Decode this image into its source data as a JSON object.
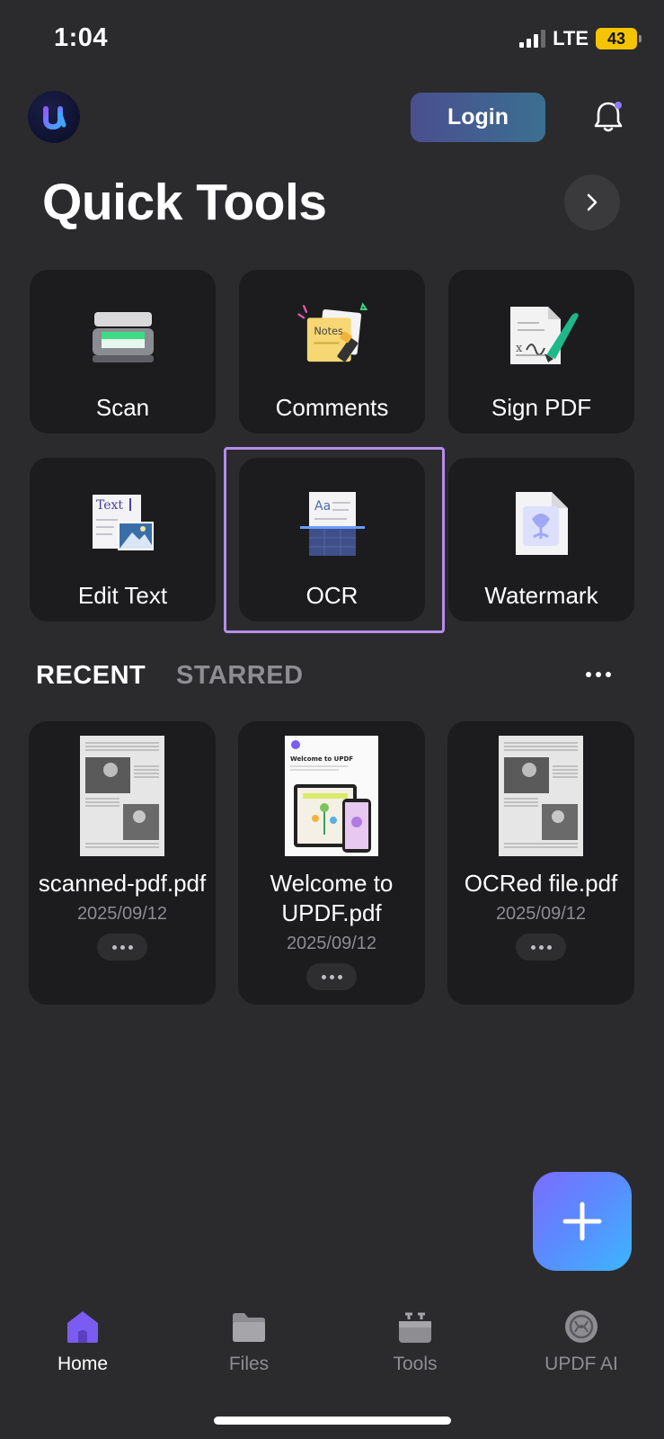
{
  "status": {
    "time": "1:04",
    "network": "LTE",
    "battery": "43"
  },
  "header": {
    "login_label": "Login"
  },
  "quick_tools": {
    "title": "Quick Tools",
    "items": [
      {
        "label": "Scan"
      },
      {
        "label": "Comments"
      },
      {
        "label": "Sign PDF"
      },
      {
        "label": "Edit Text"
      },
      {
        "label": "OCR"
      },
      {
        "label": "Watermark"
      }
    ],
    "comments_note_text": "Notes",
    "edit_text_icon_text": "Text",
    "ocr_icon_text": "Aa"
  },
  "recent": {
    "tab_recent": "RECENT",
    "tab_starred": "STARRED",
    "files": [
      {
        "name": "scanned-pdf.pdf",
        "date": "2025/09/12"
      },
      {
        "name": "Welcome to UPDF.pdf",
        "date": "2025/09/12"
      },
      {
        "name": "OCRed file.pdf",
        "date": "2025/09/12"
      }
    ],
    "welcome_thumb_title": "Welcome to UPDF"
  },
  "nav": {
    "items": [
      {
        "label": "Home",
        "active": true
      },
      {
        "label": "Files",
        "active": false
      },
      {
        "label": "Tools",
        "active": false
      },
      {
        "label": "UPDF AI",
        "active": false
      }
    ]
  },
  "colors": {
    "background": "#2b2b2d",
    "card": "#1c1c1e",
    "accent_purple": "#7b5cf0",
    "highlight_border": "#b48de8",
    "muted_text": "#8d8d92"
  }
}
